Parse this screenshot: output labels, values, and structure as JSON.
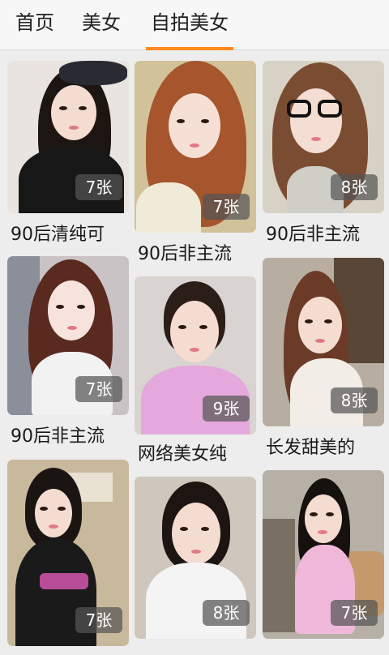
{
  "tabs": [
    {
      "label": "首页"
    },
    {
      "label": "美女"
    },
    {
      "label": "自拍美女"
    }
  ],
  "active_tab": "自拍美女",
  "colors": {
    "accent": "#ff8a1e",
    "tab_bg": "#f7f7f7",
    "page_bg": "#ededed",
    "badge_bg": "#555555"
  },
  "columns": [
    {
      "cards": [
        {
          "caption": "90后清纯可",
          "count": "7张"
        },
        {
          "caption": "90后非主流",
          "count": "7张"
        },
        {
          "caption": "",
          "count": "7张"
        }
      ]
    },
    {
      "cards": [
        {
          "caption": "90后非主流",
          "count": "7张"
        },
        {
          "caption": "网络美女纯",
          "count": "9张"
        },
        {
          "caption": "",
          "count": "8张"
        }
      ]
    },
    {
      "cards": [
        {
          "caption": "90后非主流",
          "count": "8张"
        },
        {
          "caption": "长发甜美的",
          "count": "8张"
        },
        {
          "caption": "",
          "count": "7张"
        }
      ]
    }
  ]
}
